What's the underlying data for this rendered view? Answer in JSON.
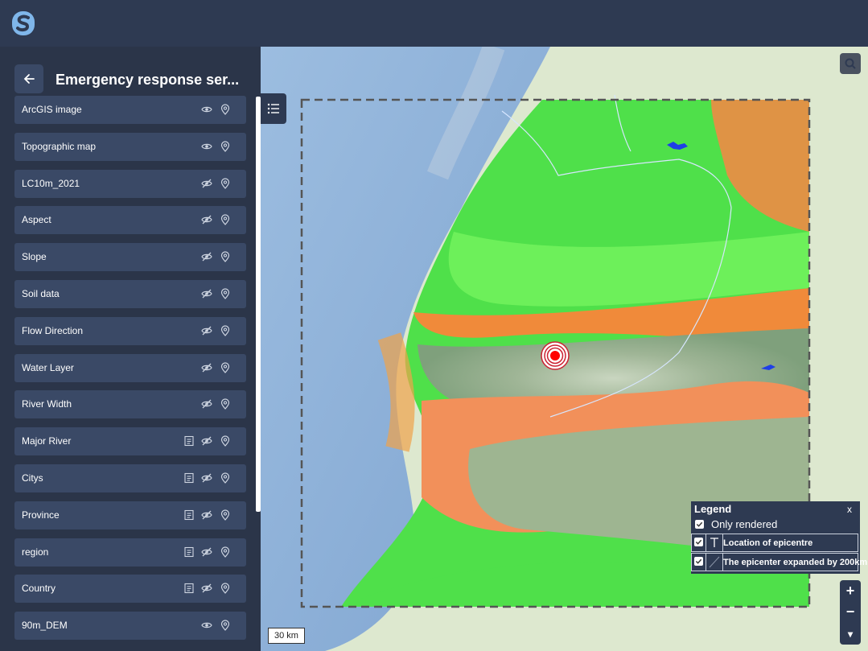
{
  "app": {
    "logo_icon": "s-logo-icon",
    "accent_color": "#2e3a52"
  },
  "sidebar": {
    "title": "Emergency response ser...",
    "back_icon": "arrow-left-icon",
    "layers": [
      {
        "label": "ArcGIS image",
        "visible": true,
        "has_legend": false
      },
      {
        "label": "Topographic map",
        "visible": true,
        "has_legend": false
      },
      {
        "label": "LC10m_2021",
        "visible": false,
        "has_legend": false
      },
      {
        "label": "Aspect",
        "visible": false,
        "has_legend": false
      },
      {
        "label": "Slope",
        "visible": false,
        "has_legend": false
      },
      {
        "label": "Soil data",
        "visible": false,
        "has_legend": false
      },
      {
        "label": "Flow Direction",
        "visible": false,
        "has_legend": false
      },
      {
        "label": "Water Layer",
        "visible": false,
        "has_legend": false
      },
      {
        "label": "River Width",
        "visible": false,
        "has_legend": false
      },
      {
        "label": "Major River",
        "visible": false,
        "has_legend": true
      },
      {
        "label": "Citys",
        "visible": false,
        "has_legend": true
      },
      {
        "label": "Province",
        "visible": false,
        "has_legend": true
      },
      {
        "label": "region",
        "visible": false,
        "has_legend": true
      },
      {
        "label": "Country",
        "visible": false,
        "has_legend": true
      },
      {
        "label": "90m_DEM",
        "visible": true,
        "has_legend": false
      }
    ]
  },
  "map": {
    "scale_label": "30 km",
    "zoom_in": "+",
    "zoom_out": "−",
    "more": "▾",
    "legend": {
      "title": "Legend",
      "close": "x",
      "only_rendered": "Only rendered",
      "items": [
        {
          "label": "Location of epicentre",
          "checked": true
        },
        {
          "label": "The epicenter expanded by 200km",
          "checked": true
        }
      ]
    }
  }
}
